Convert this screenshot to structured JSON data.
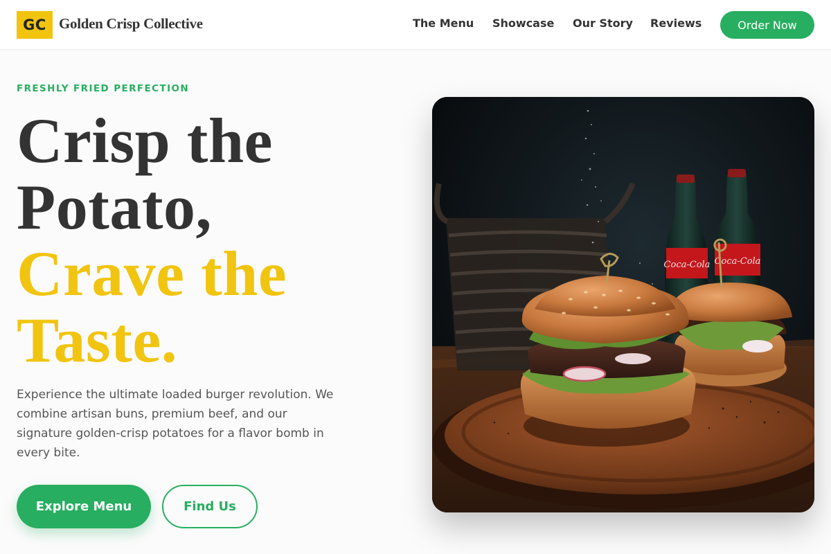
{
  "nav": {
    "logo_badge": "GC",
    "logo_text": "Golden Crisp Collective",
    "links": [
      "The Menu",
      "Showcase",
      "Our Story",
      "Reviews"
    ],
    "cta": "Order Now"
  },
  "hero": {
    "eyebrow": "FRESHLY FRIED PERFECTION",
    "headline_dark": [
      "Crisp the",
      "Potato,"
    ],
    "headline_gold": [
      "Crave the",
      "Taste."
    ],
    "description": "Experience the ultimate loaded burger revolution. We combine artisan buns, premium beef, and our signature golden-crisp potatoes for a flavor bomb in every bite.",
    "primary_button": "Explore Menu",
    "secondary_button": "Find Us",
    "image": {
      "subject": "two-gourmet-burgers-on-wooden-board",
      "bottle_label": "Coca-Cola"
    }
  },
  "colors": {
    "accent_green": "#27ae60",
    "accent_gold": "#f1c40f",
    "text_dark": "#333333",
    "text_muted": "#555555"
  }
}
